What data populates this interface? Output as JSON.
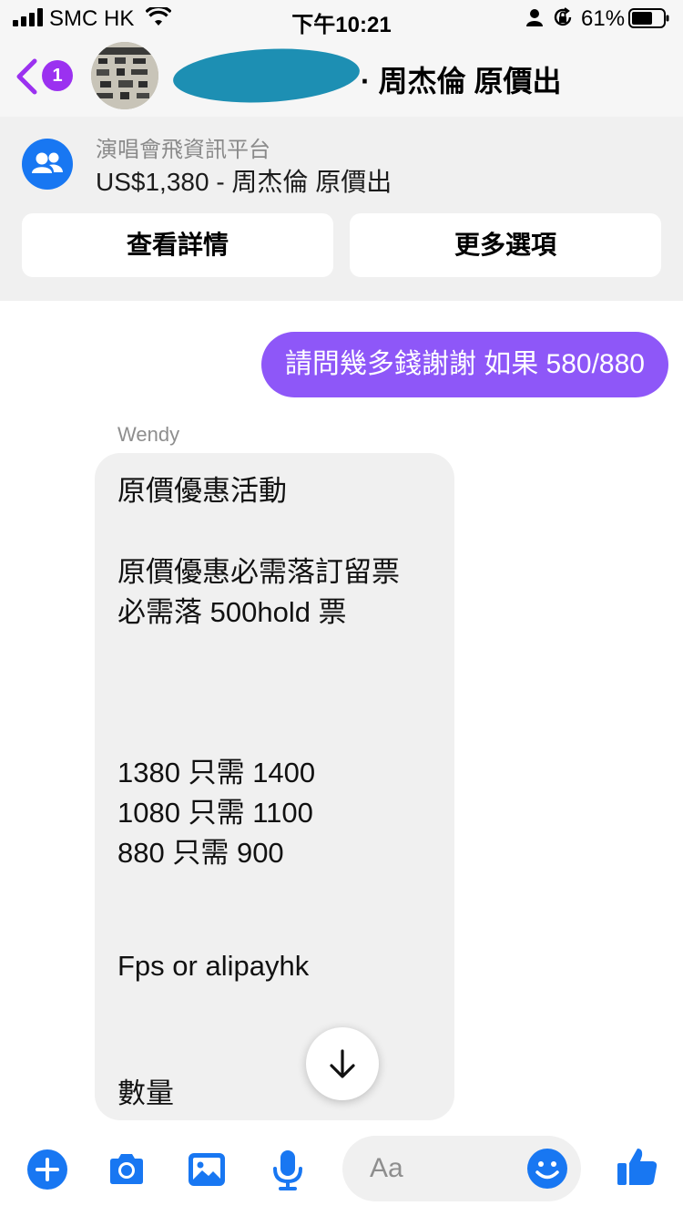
{
  "status_bar": {
    "carrier": "SMC HK",
    "time": "下午10:21",
    "battery": "61%"
  },
  "header": {
    "back_badge": "1",
    "title": "· 周杰倫 原價出"
  },
  "context": {
    "group_name": "演唱會飛資訊平台",
    "listing": "US$1,380 - 周杰倫 原價出",
    "buttons": [
      "查看詳情",
      "更多選項"
    ]
  },
  "messages": {
    "sent": "請問幾多錢謝謝 如果 580/880",
    "sender": "Wendy",
    "received_lines": [
      "原價優惠活動",
      "原價優惠必需落訂留票",
      "必需落 500hold 票",
      "1380 只需 1400",
      "1080 只需 1100",
      "880 只需 900",
      "Fps or alipayhk",
      "數量"
    ]
  },
  "composer": {
    "placeholder": "Aa"
  },
  "colors": {
    "accent": "#8e57f8",
    "messenger_blue": "#1877f2",
    "badge_purple": "#9b31f0",
    "redaction": "#1d8fb3"
  },
  "icons": [
    "back-chevron-icon",
    "avatar",
    "group-icon",
    "plus-icon",
    "camera-icon",
    "gallery-icon",
    "microphone-icon",
    "emoji-icon",
    "thumbs-up-icon",
    "arrow-down-icon"
  ]
}
